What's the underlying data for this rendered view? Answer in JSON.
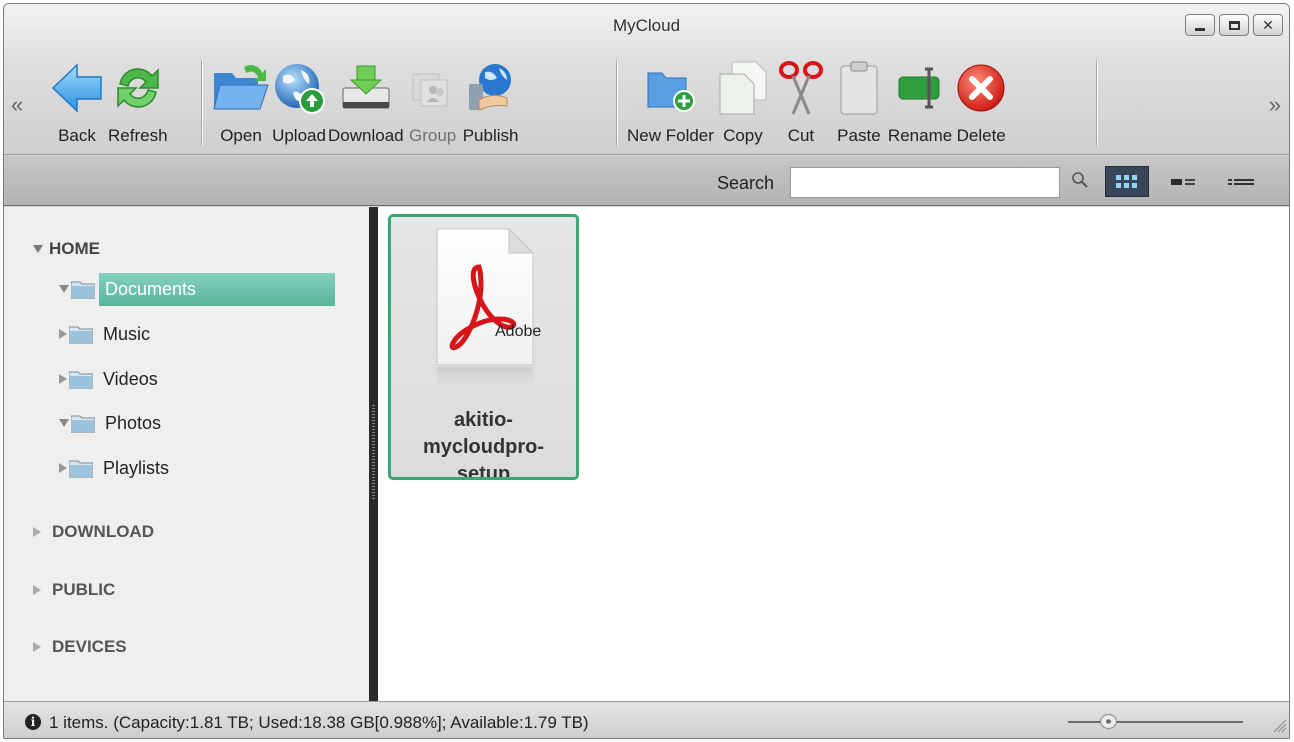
{
  "window": {
    "title": "MyCloud"
  },
  "toolbar": {
    "items": [
      {
        "label": "Back",
        "icon": "back-arrow-icon"
      },
      {
        "label": "Refresh",
        "icon": "refresh-icon"
      },
      {
        "label": "Open",
        "icon": "open-folder-icon"
      },
      {
        "label": "Upload",
        "icon": "upload-globe-icon"
      },
      {
        "label": "Download",
        "icon": "download-icon"
      },
      {
        "label": "Group",
        "icon": "group-icon",
        "disabled": true
      },
      {
        "label": "Publish",
        "icon": "publish-icon"
      },
      {
        "label": "New Folder",
        "icon": "new-folder-icon"
      },
      {
        "label": "Copy",
        "icon": "copy-icon"
      },
      {
        "label": "Cut",
        "icon": "scissors-icon"
      },
      {
        "label": "Paste",
        "icon": "paste-icon"
      },
      {
        "label": "Rename",
        "icon": "rename-icon"
      },
      {
        "label": "Delete",
        "icon": "delete-icon"
      }
    ],
    "scroll_left": "«",
    "scroll_right": "»"
  },
  "search": {
    "label": "Search",
    "value": "",
    "placeholder": ""
  },
  "sidebar": {
    "roots": [
      {
        "label": "HOME",
        "expanded": true
      },
      {
        "label": "DOWNLOAD",
        "expanded": false
      },
      {
        "label": "PUBLIC",
        "expanded": false
      },
      {
        "label": "DEVICES",
        "expanded": false
      }
    ],
    "home_children": [
      {
        "label": "Documents",
        "expanded": true,
        "selected": true
      },
      {
        "label": "Music",
        "expanded": false
      },
      {
        "label": "Videos",
        "expanded": false
      },
      {
        "label": "Photos",
        "expanded": true
      },
      {
        "label": "Playlists",
        "expanded": false
      }
    ]
  },
  "content": {
    "files": [
      {
        "name_line1": "akitio-",
        "name_line2": "mycloudpro-",
        "name_line3": "setup",
        "icon_text": "Adobe",
        "type": "pdf"
      }
    ]
  },
  "status": {
    "text": "1 items. (Capacity:1.81 TB; Used:18.38 GB[0.988%]; Available:1.79 TB)",
    "zoom_level": 0.2
  },
  "colors": {
    "accent_green": "#3aa871",
    "selected_bg": "#58b59c",
    "adobe_red": "#d7141a"
  }
}
